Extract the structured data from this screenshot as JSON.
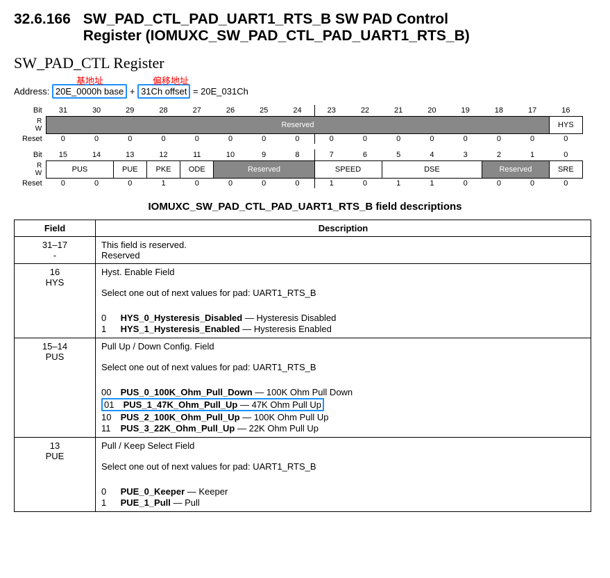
{
  "heading": {
    "number": "32.6.166",
    "title_line1": "SW_PAD_CTL_PAD_UART1_RTS_B SW PAD Control",
    "title_line2": "Register (IOMUXC_SW_PAD_CTL_PAD_UART1_RTS_B)"
  },
  "subtitle": "SW_PAD_CTL Register",
  "annotations": {
    "base": "基地址",
    "offset": "偏移地址"
  },
  "address": {
    "prefix": "Address: ",
    "base": "20E_0000h base",
    "plus": " + ",
    "offset": "31Ch offset",
    "eq": " = 20E_031Ch"
  },
  "bit_labels": {
    "bit": "Bit",
    "reset": "Reset",
    "rw": "R\nW"
  },
  "bits_hi": [
    "31",
    "30",
    "29",
    "28",
    "27",
    "26",
    "25",
    "24",
    "23",
    "22",
    "21",
    "20",
    "19",
    "18",
    "17",
    "16"
  ],
  "bits_lo": [
    "15",
    "14",
    "13",
    "12",
    "11",
    "10",
    "9",
    "8",
    "7",
    "6",
    "5",
    "4",
    "3",
    "2",
    "1",
    "0"
  ],
  "fields_hi": [
    {
      "name": "Reserved",
      "span": 15,
      "reserved": true
    },
    {
      "name": "HYS",
      "span": 1,
      "reserved": false
    }
  ],
  "fields_lo": [
    {
      "name": "PUS",
      "span": 2,
      "reserved": false
    },
    {
      "name": "PUE",
      "span": 1,
      "reserved": false
    },
    {
      "name": "PKE",
      "span": 1,
      "reserved": false
    },
    {
      "name": "ODE",
      "span": 1,
      "reserved": false
    },
    {
      "name": "Reserved",
      "span": 3,
      "reserved": true
    },
    {
      "name": "SPEED",
      "span": 2,
      "reserved": false
    },
    {
      "name": "DSE",
      "span": 3,
      "reserved": false
    },
    {
      "name": "Reserved",
      "span": 2,
      "reserved": true
    },
    {
      "name": "SRE",
      "span": 1,
      "reserved": false
    }
  ],
  "reset_hi": [
    "0",
    "0",
    "0",
    "0",
    "0",
    "0",
    "0",
    "0",
    "0",
    "0",
    "0",
    "0",
    "0",
    "0",
    "0",
    "0"
  ],
  "reset_lo": [
    "0",
    "0",
    "0",
    "1",
    "0",
    "0",
    "0",
    "0",
    "1",
    "0",
    "1",
    "1",
    "0",
    "0",
    "0",
    "0"
  ],
  "desc_title": "IOMUXC_SW_PAD_CTL_PAD_UART1_RTS_B field descriptions",
  "table_head": {
    "field": "Field",
    "desc": "Description"
  },
  "rows": [
    {
      "field_top": "31–17",
      "field_bot": "-",
      "text": "This field is reserved.\nReserved",
      "vals": []
    },
    {
      "field_top": "16",
      "field_bot": "HYS",
      "text": "Hyst. Enable Field\n\nSelect one out of next values for pad: UART1_RTS_B",
      "vals": [
        {
          "bits": "0",
          "name": "HYS_0_Hysteresis_Disabled",
          "tail": " — Hysteresis Disabled",
          "hl": false
        },
        {
          "bits": "1",
          "name": "HYS_1_Hysteresis_Enabled",
          "tail": " — Hysteresis Enabled",
          "hl": false
        }
      ]
    },
    {
      "field_top": "15–14",
      "field_bot": "PUS",
      "text": "Pull Up / Down Config. Field\n\nSelect one out of next values for pad: UART1_RTS_B",
      "vals": [
        {
          "bits": "00",
          "name": "PUS_0_100K_Ohm_Pull_Down",
          "tail": " — 100K Ohm Pull Down",
          "hl": false
        },
        {
          "bits": "01",
          "name": "PUS_1_47K_Ohm_Pull_Up",
          "tail": " — 47K Ohm Pull Up",
          "hl": true
        },
        {
          "bits": "10",
          "name": "PUS_2_100K_Ohm_Pull_Up",
          "tail": " — 100K Ohm Pull Up",
          "hl": false
        },
        {
          "bits": "11",
          "name": "PUS_3_22K_Ohm_Pull_Up",
          "tail": " — 22K Ohm Pull Up",
          "hl": false
        }
      ]
    },
    {
      "field_top": "13",
      "field_bot": "PUE",
      "text": "Pull / Keep Select Field\n\nSelect one out of next values for pad: UART1_RTS_B",
      "vals": [
        {
          "bits": "0",
          "name": "PUE_0_Keeper",
          "tail": " — Keeper",
          "hl": false
        },
        {
          "bits": "1",
          "name": "PUE_1_Pull",
          "tail": " — Pull",
          "hl": false
        }
      ]
    }
  ]
}
